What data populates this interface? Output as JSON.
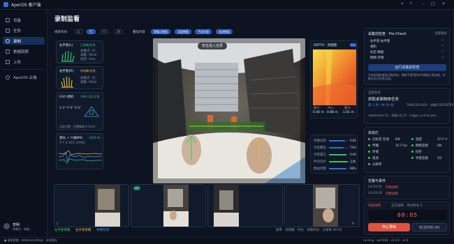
{
  "app": {
    "title": "AperOS 客户端"
  },
  "window": {
    "icons": [
      "pin",
      "help",
      "minimize",
      "maximize",
      "close"
    ]
  },
  "sidebar": {
    "items": [
      {
        "label": "设备",
        "icon": "device-icon",
        "active": false
      },
      {
        "label": "任务",
        "icon": "task-icon",
        "active": false
      },
      {
        "label": "录制",
        "icon": "record-icon",
        "active": true
      },
      {
        "label": "数据回顾",
        "icon": "review-icon",
        "active": false
      },
      {
        "label": "上传",
        "icon": "upload-icon",
        "active": false
      }
    ],
    "cloud": "AperOS 云端",
    "user": {
      "name": "李明",
      "role": "采集员 · 电脑..."
    }
  },
  "page": {
    "title": "录制监看"
  },
  "toolbar": {
    "view_label": "视角布局",
    "view_options": [
      "1L",
      "F1",
      "F3",
      "1R"
    ],
    "view_active": "F1",
    "overlay_label": "叠加内容",
    "overlays": [
      "骨骼点数据",
      "深度数据",
      "手部关键",
      "轨迹数据"
    ]
  },
  "sensors": [
    {
      "title": "左手套(L)",
      "status": "已采集/在线",
      "lines": [
        "关键点: 21",
        "采集: 92Hz",
        "延迟: 1ms"
      ],
      "status_color": "#35c46b"
    },
    {
      "title": "右手套(R)",
      "status": "待采集/在线",
      "lines": [
        "关键点: 21",
        "采集: 92Hz"
      ],
      "status_color": "#e3b341"
    },
    {
      "title": "EGO 相机",
      "status": "30Hz 运行正常",
      "lines": [
        "X 3° P 9° R 0°",
        "设定位置 - 位置精度 0.5mm"
      ],
      "status_color": "#35c46b"
    },
    {
      "title": "激光 + 六轴IMU",
      "status": "1000 Hz",
      "lines": [
        "X Y Z  ACC  GYRO"
      ],
      "status_color": "#35c46b"
    }
  ],
  "camera": {
    "badge": "单击进入全屏"
  },
  "depth": {
    "title": "DEPTH · 深度图",
    "legend_min": "近",
    "legend_max": "远",
    "stats": [
      {
        "label": "最小",
        "value": "0.40 m"
      },
      {
        "label": "中心",
        "value": "0.88 m"
      },
      {
        "label": "最大",
        "value": "1.61 m"
      }
    ]
  },
  "metrics": {
    "items": [
      {
        "label": "骨骼追踪",
        "value": 0.82
      },
      {
        "label": "深度覆盖",
        "value": 0.74
      },
      {
        "label": "手部置信",
        "value": 0.9
      },
      {
        "label": "时间同步",
        "value": 0.95
      },
      {
        "label": "数据完整",
        "value": 0.88
      }
    ],
    "values": [
      "0.82",
      "74%",
      "0.90",
      "正常",
      "88%"
    ]
  },
  "thumbnails": [
    {
      "id": "L",
      "badge": ""
    },
    {
      "id": "F1",
      "badge": "F1"
    },
    {
      "id": "F3",
      "badge": "F3"
    },
    {
      "id": "R",
      "badge": ""
    }
  ],
  "legend": {
    "items": [
      "左手套骨骼",
      "右手套骨骼",
      "骨骼检测"
    ],
    "right": "帧率 · 丢帧数 · 时长 · 采集时间 · 已录制 00:05"
  },
  "precheck": {
    "title": "采集前检查 · Pre-Check",
    "sub": "全部通过",
    "items": [
      "左手套·右手套",
      "相机",
      "标定·数据",
      "网络·存储"
    ],
    "button": "运行采集前检查",
    "note": "开始前请检查各设备状态，确保手套/相机/传感器正常连接，并确认标注信息无误。"
  },
  "task": {
    "title": "当前任务",
    "name": "抓取桌面物体任务",
    "meta": "第 1 条 / 共 20 条",
    "id": "TASK-2024-001 · 场景EGOCENTRIC 01",
    "detail": "registration 01 · 采集方式 01 · trigger_events.json"
  },
  "status": {
    "title": "状态灯",
    "rows": [
      {
        "label": "已标定·在线",
        "value": "8/8"
      },
      {
        "label": "传输",
        "value": "10.7 Fps"
      },
      {
        "label": "存储",
        "value": ""
      },
      {
        "label": "电池",
        "value": ""
      },
      {
        "label": "分辨率",
        "value": ""
      }
    ],
    "right": [
      {
        "label": "温度",
        "value": "37.0 ℃"
      },
      {
        "label": "网络连接",
        "value": "ON"
      },
      {
        "label": "同步",
        "value": ""
      },
      {
        "label": "手套连接",
        "value": "2/2"
      }
    ]
  },
  "events": {
    "title": "告警与事件",
    "items": [
      {
        "time": "14:03:21",
        "text": "开始录制"
      },
      {
        "time": "14:03:26",
        "text": "开始录制"
      }
    ]
  },
  "session": {
    "label": "开始录制",
    "info": "正在录制 · 单位时长 5",
    "timer": "00:05",
    "stop": "停止录制",
    "mark": "标注时刻 (M)"
  },
  "footer": {
    "left": "● 录制就绪 · data/recordings · 本地保存",
    "right": "running · aarch64 · v2.4.0 · v2.4"
  }
}
